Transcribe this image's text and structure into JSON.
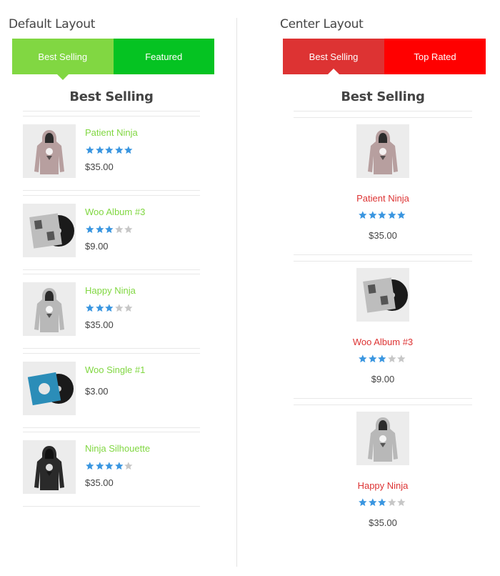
{
  "colors": {
    "default_tab_active": "#81d742",
    "default_tab_inactive": "#05c322",
    "center_tab_active": "#dd3333",
    "center_tab_inactive": "#ff0000",
    "default_link": "#81d742",
    "center_link": "#dd3333",
    "star_filled": "#3a96e0",
    "star_empty": "#c7c7c7"
  },
  "default_layout": {
    "title": "Default Layout",
    "tabs": [
      {
        "label": "Best Selling",
        "active": true
      },
      {
        "label": "Featured",
        "active": false
      }
    ],
    "section_title": "Best Selling",
    "products": [
      {
        "name": "Patient Ninja",
        "rating": 5,
        "price": "$35.00",
        "image": "hoodie-pink-icon"
      },
      {
        "name": "Woo Album #3",
        "rating": 3,
        "price": "$9.00",
        "image": "album-icon"
      },
      {
        "name": "Happy Ninja",
        "rating": 3,
        "price": "$35.00",
        "image": "hoodie-grey-icon"
      },
      {
        "name": "Woo Single #1",
        "rating": 0,
        "price": "$3.00",
        "image": "single-icon"
      },
      {
        "name": "Ninja Silhouette",
        "rating": 4,
        "price": "$35.00",
        "image": "hoodie-black-icon"
      }
    ]
  },
  "center_layout": {
    "title": "Center Layout",
    "tabs": [
      {
        "label": "Best Selling",
        "active": true
      },
      {
        "label": "Top Rated",
        "active": false
      }
    ],
    "section_title": "Best Selling",
    "products": [
      {
        "name": "Patient Ninja",
        "rating": 5,
        "price": "$35.00",
        "image": "hoodie-pink-icon"
      },
      {
        "name": "Woo Album #3",
        "rating": 3,
        "price": "$9.00",
        "image": "album-icon"
      },
      {
        "name": "Happy Ninja",
        "rating": 3,
        "price": "$35.00",
        "image": "hoodie-grey-icon"
      }
    ]
  }
}
